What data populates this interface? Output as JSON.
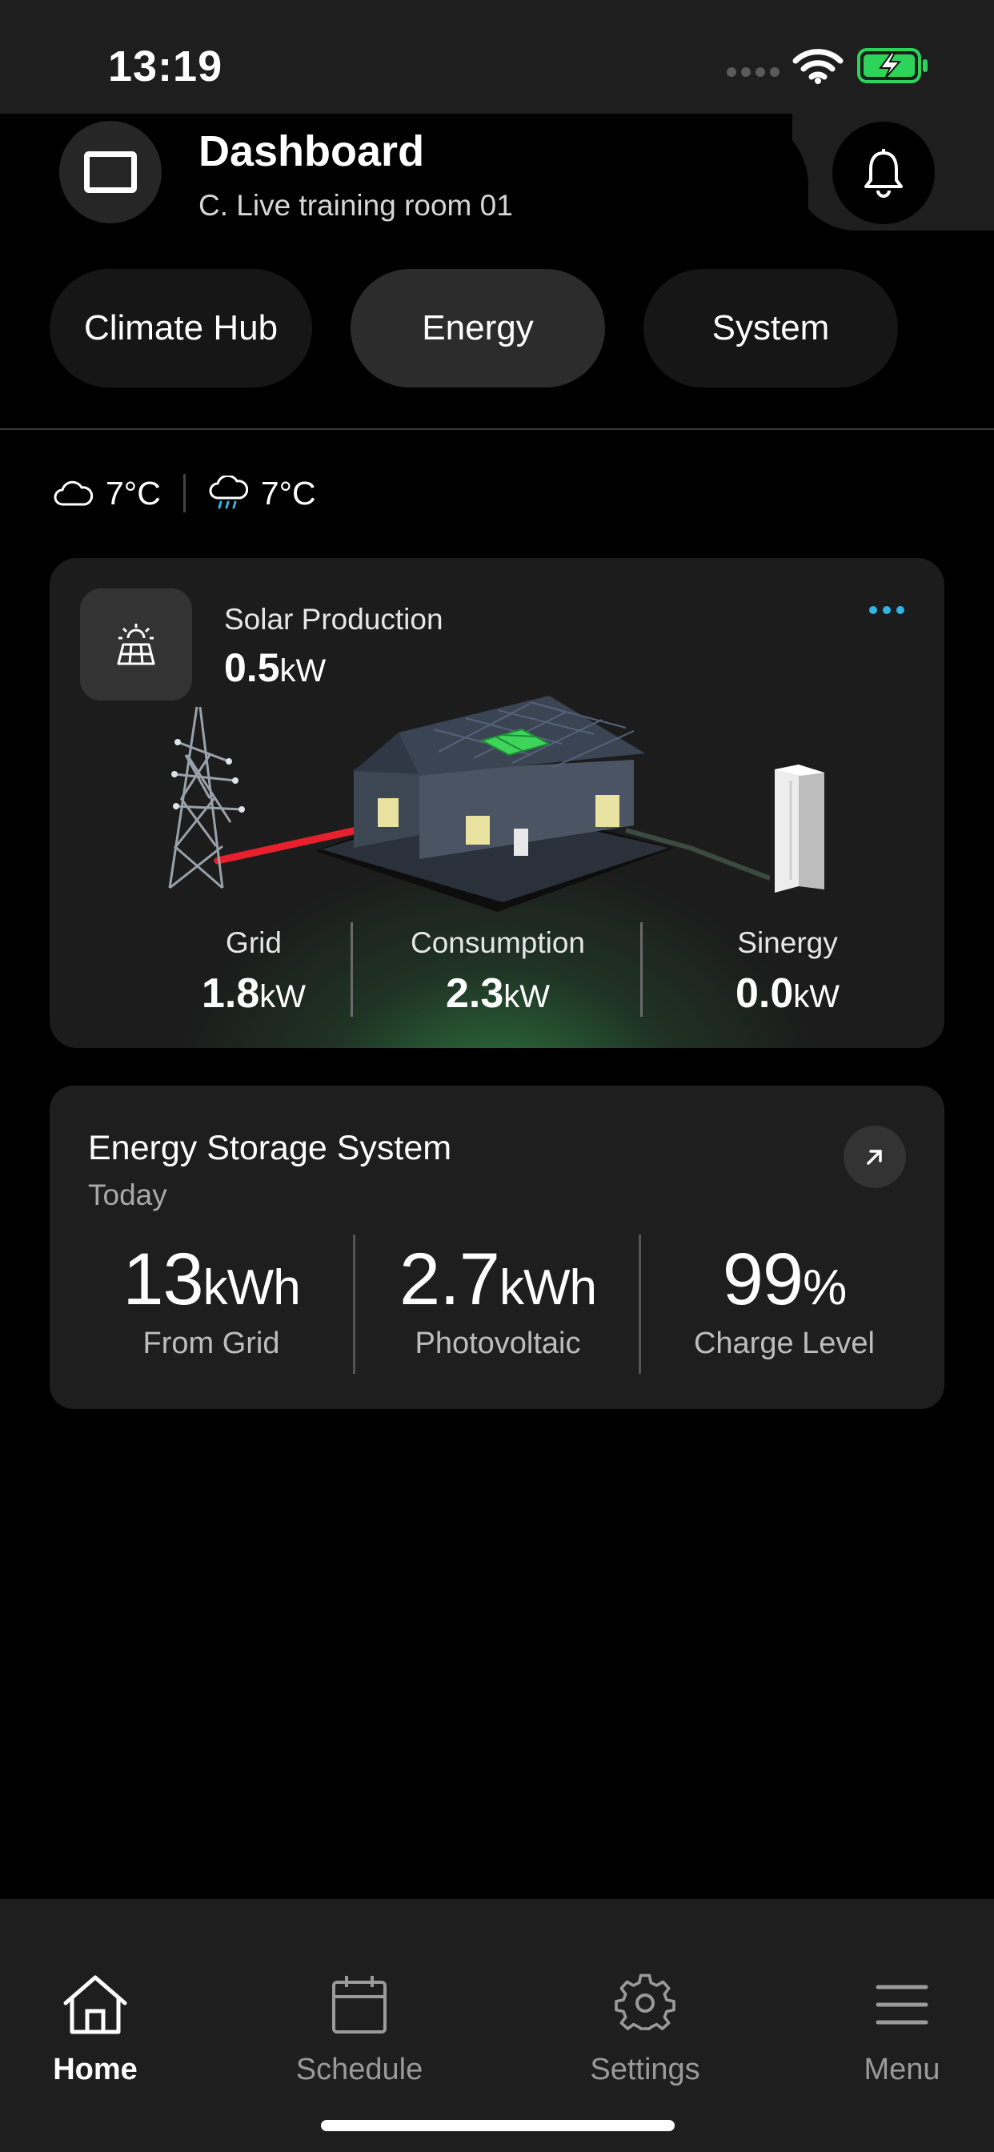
{
  "status_bar": {
    "time": "13:19"
  },
  "header": {
    "title": "Dashboard",
    "subtitle": "C. Live training room 01"
  },
  "tabs": [
    {
      "label": "Climate Hub",
      "active": false
    },
    {
      "label": "Energy",
      "active": true
    },
    {
      "label": "System",
      "active": false
    }
  ],
  "weather": [
    {
      "icon": "cloud-icon",
      "temp": "7°C"
    },
    {
      "icon": "rain-cloud-icon",
      "temp": "7°C"
    }
  ],
  "solar_card": {
    "label": "Solar Production",
    "value": "0.5",
    "unit": "kW",
    "stats": [
      {
        "label": "Grid",
        "value": "1.8",
        "unit": "kW"
      },
      {
        "label": "Consumption",
        "value": "2.3",
        "unit": "kW"
      },
      {
        "label": "Sinergy",
        "value": "0.0",
        "unit": "kW"
      }
    ],
    "colors": {
      "grid_line": "#e8202e",
      "solar_panel": "#3ed35a",
      "glow": "#3cbe5a",
      "more_dots": "#2fb6e6"
    }
  },
  "ess_card": {
    "title": "Energy Storage System",
    "subtitle": "Today",
    "stats": [
      {
        "value": "13",
        "unit": "kWh",
        "caption": "From Grid"
      },
      {
        "value": "2.7",
        "unit": "kWh",
        "caption": "Photovoltaic"
      },
      {
        "value": "99",
        "unit": "%",
        "caption": "Charge Level"
      }
    ]
  },
  "bottom_nav": [
    {
      "label": "Home",
      "icon": "home-icon",
      "active": true
    },
    {
      "label": "Schedule",
      "icon": "calendar-icon",
      "active": false
    },
    {
      "label": "Settings",
      "icon": "gear-icon",
      "active": false
    },
    {
      "label": "Menu",
      "icon": "hamburger-menu-icon",
      "active": false
    }
  ]
}
